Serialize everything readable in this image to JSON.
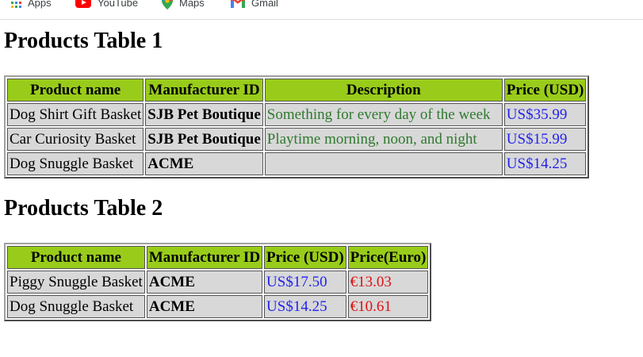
{
  "bookmarks": {
    "items": [
      {
        "label": "Apps",
        "icon": "apps-grid-icon"
      },
      {
        "label": "YouTube",
        "icon": "youtube-icon"
      },
      {
        "label": "Maps",
        "icon": "maps-icon"
      },
      {
        "label": "Gmail",
        "icon": "gmail-icon"
      }
    ]
  },
  "table1": {
    "heading": "Products Table 1",
    "headers": [
      "Product name",
      "Manufacturer ID",
      "Description",
      "Price (USD)"
    ],
    "rows": [
      [
        "Dog Shirt Gift Basket",
        "SJB Pet Boutique",
        "Something for every day of the week",
        "US$35.99"
      ],
      [
        "Car Curiosity Basket",
        "SJB Pet Boutique",
        "Playtime morning, noon, and night",
        "US$15.99"
      ],
      [
        "Dog Snuggle Basket",
        "ACME",
        "",
        "US$14.25"
      ]
    ]
  },
  "table2": {
    "heading": "Products Table 2",
    "headers": [
      "Product name",
      "Manufacturer ID",
      "Price (USD)",
      "Price(Euro)"
    ],
    "rows": [
      [
        "Piggy Snuggle Basket",
        "ACME",
        "US$17.50",
        "€13.03"
      ],
      [
        "Dog Snuggle Basket",
        "ACME",
        "US$14.25",
        "€10.61"
      ]
    ]
  },
  "colors": {
    "header_bg": "#99cc1a",
    "cell_bg": "#d8d8d8",
    "description_text": "#2f7a2f",
    "usd_text": "#2222ee",
    "euro_text": "#dd1111"
  }
}
